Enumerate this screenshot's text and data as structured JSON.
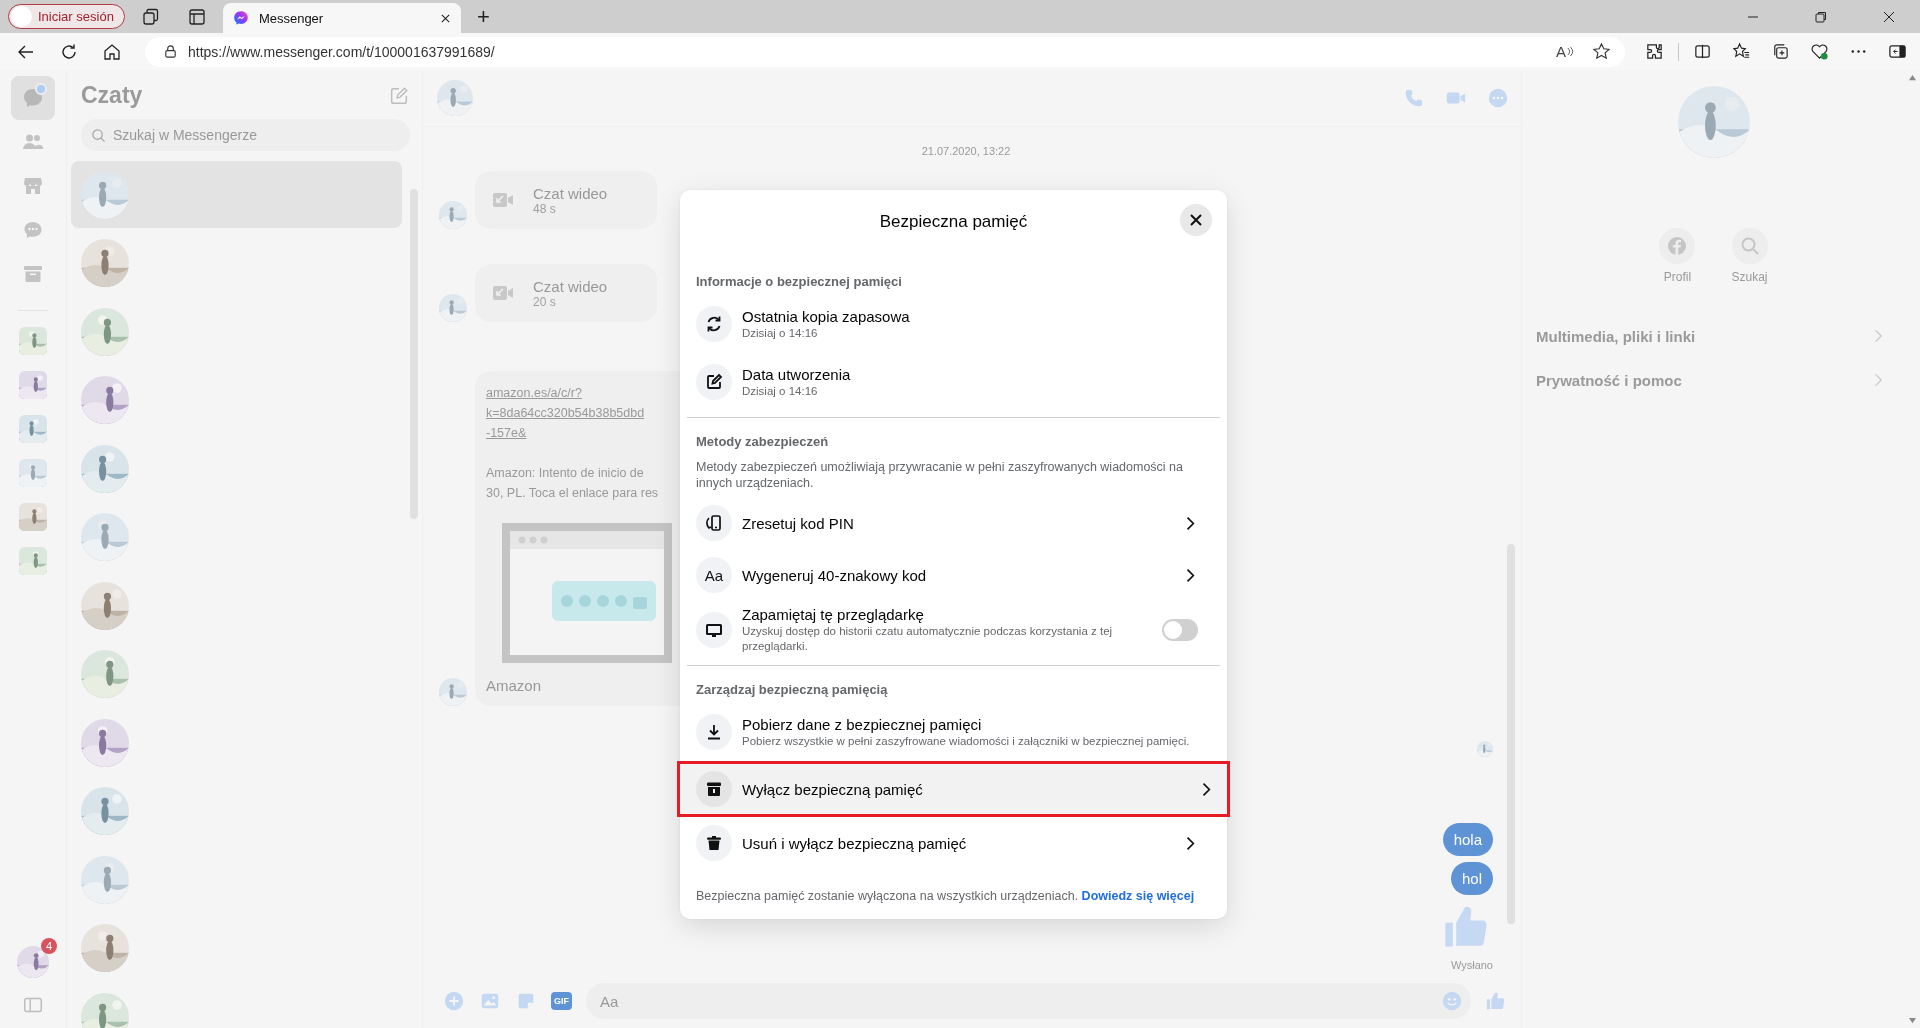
{
  "browser": {
    "profile_button": "Iniciar sesión",
    "tabs": [
      {
        "title": "Messenger",
        "selected": true
      }
    ],
    "new_tab": "+",
    "url": "https://www.messenger.com/t/100001637991689/",
    "read_aloud": "A"
  },
  "rail": {
    "items": [
      {
        "selected": true,
        "unread": true
      },
      {
        "selected": false,
        "unread": false
      },
      {
        "selected": false,
        "unread": false
      },
      {
        "selected": false,
        "unread": false
      },
      {
        "selected": false,
        "unread": false
      }
    ],
    "profile_badge": "4"
  },
  "chats": {
    "title": "Czaty",
    "search": {
      "placeholder": "Szukaj w Messengerze"
    },
    "items": [
      {
        "selected": true
      },
      {
        "selected": false
      },
      {
        "selected": false
      },
      {
        "selected": false
      },
      {
        "selected": false
      },
      {
        "selected": false
      },
      {
        "selected": false
      },
      {
        "selected": false
      },
      {
        "selected": false
      },
      {
        "selected": false
      },
      {
        "selected": false
      },
      {
        "selected": false
      },
      {
        "selected": false
      }
    ]
  },
  "conversation": {
    "date": "21.07.2020, 13:22",
    "calls": [
      {
        "title": "Czat wideo",
        "duration": "48 s"
      },
      {
        "title": "Czat wideo",
        "duration": "20 s"
      }
    ],
    "link_message": {
      "link_lines": [
        "amazon.es/a/c/r?",
        "k=8da64cc320b54b38b5dbd",
        "-157e&"
      ],
      "text_lines": [
        "Amazon: Intento de inicio de",
        "30, PL. Toca el enlace para res"
      ],
      "sender": "Amazon"
    },
    "sent": [
      {
        "text": "hola"
      },
      {
        "text": "hol"
      }
    ],
    "status": "Wysłano",
    "composer": {
      "placeholder": "Aa",
      "gif": "GIF"
    }
  },
  "details": {
    "actions": [
      {
        "label": "Profil"
      },
      {
        "label": "Szukaj"
      }
    ],
    "sections": [
      {
        "label": "Multimedia, pliki i linki"
      },
      {
        "label": "Prywatność i pomoc"
      }
    ]
  },
  "dialog": {
    "title": "Bezpieczna pamięć",
    "sections": [
      {
        "title": "Informacje o bezpiecznej pamięci",
        "items": [
          {
            "kind": "info",
            "title": "Ostatnia kopia zapasowa",
            "subtitle": "Dzisiaj o 14:16",
            "highlighted": false
          },
          {
            "kind": "info",
            "title": "Data utworzenia",
            "subtitle": "Dzisiaj o 14:16",
            "highlighted": false
          }
        ]
      },
      {
        "title": "Metody zabezpieczeń",
        "description": "Metody zabezpieczeń umożliwiają przywracanie w pełni zaszyfrowanych wiadomości na innych urządzeniach.",
        "items": [
          {
            "kind": "nav",
            "title": "Zresetuj kod PIN",
            "highlighted": false
          },
          {
            "kind": "nav",
            "title": "Wygeneruj 40-znakowy kod",
            "icon_text": "Aa",
            "highlighted": false
          },
          {
            "kind": "toggle",
            "title": "Zapamiętaj tę przeglądarkę",
            "subtitle": "Uzyskuj dostęp do historii czatu automatycznie podczas korzystania z tej przeglądarki.",
            "on": false,
            "highlighted": false
          }
        ]
      },
      {
        "title": "Zarządzaj bezpieczną pamięcią",
        "items": [
          {
            "kind": "info",
            "title": "Pobierz dane z bezpiecznej pamięci",
            "subtitle": "Pobierz wszystkie w pełni zaszyfrowane wiadomości i załączniki w bezpiecznej pamięci.",
            "highlighted": false
          },
          {
            "kind": "nav",
            "title": "Wyłącz bezpieczną pamięć",
            "highlighted": true
          },
          {
            "kind": "nav",
            "title": "Usuń i wyłącz bezpieczną pamięć",
            "highlighted": false
          }
        ]
      }
    ],
    "footer": {
      "text": "Bezpieczna pamięć zostanie wyłączona na wszystkich urządzeniach.",
      "link": "Dowiedz się więcej"
    }
  }
}
